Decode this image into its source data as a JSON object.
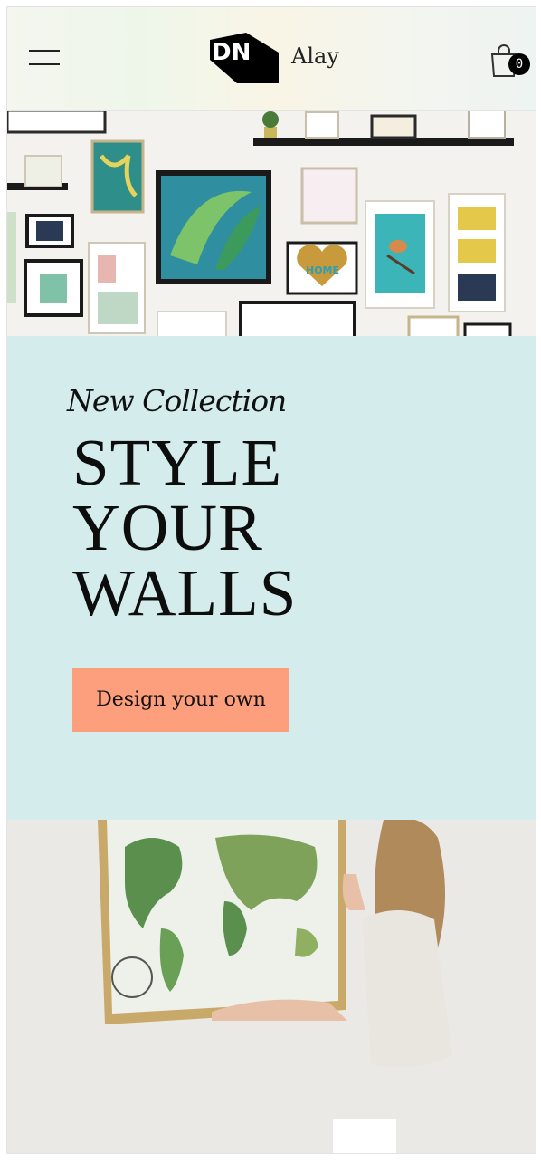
{
  "header": {
    "menu_icon": "hamburger-menu-icon",
    "logo_text": "DN",
    "brand_name": "Alay",
    "cart_icon": "shopping-bag-icon",
    "cart_count": "0"
  },
  "hero": {
    "image_desc": "gallery-wall-photo",
    "heart_sign": "HOME"
  },
  "promo": {
    "eyebrow": "New Collection",
    "headline_lines": [
      "STYLE",
      "YOUR",
      "WALLS"
    ],
    "cta_label": "Design your own",
    "background": "#d4ecec",
    "cta_color": "#fd9e7c"
  },
  "feature": {
    "image_desc": "woman-hanging-world-map-photo"
  }
}
